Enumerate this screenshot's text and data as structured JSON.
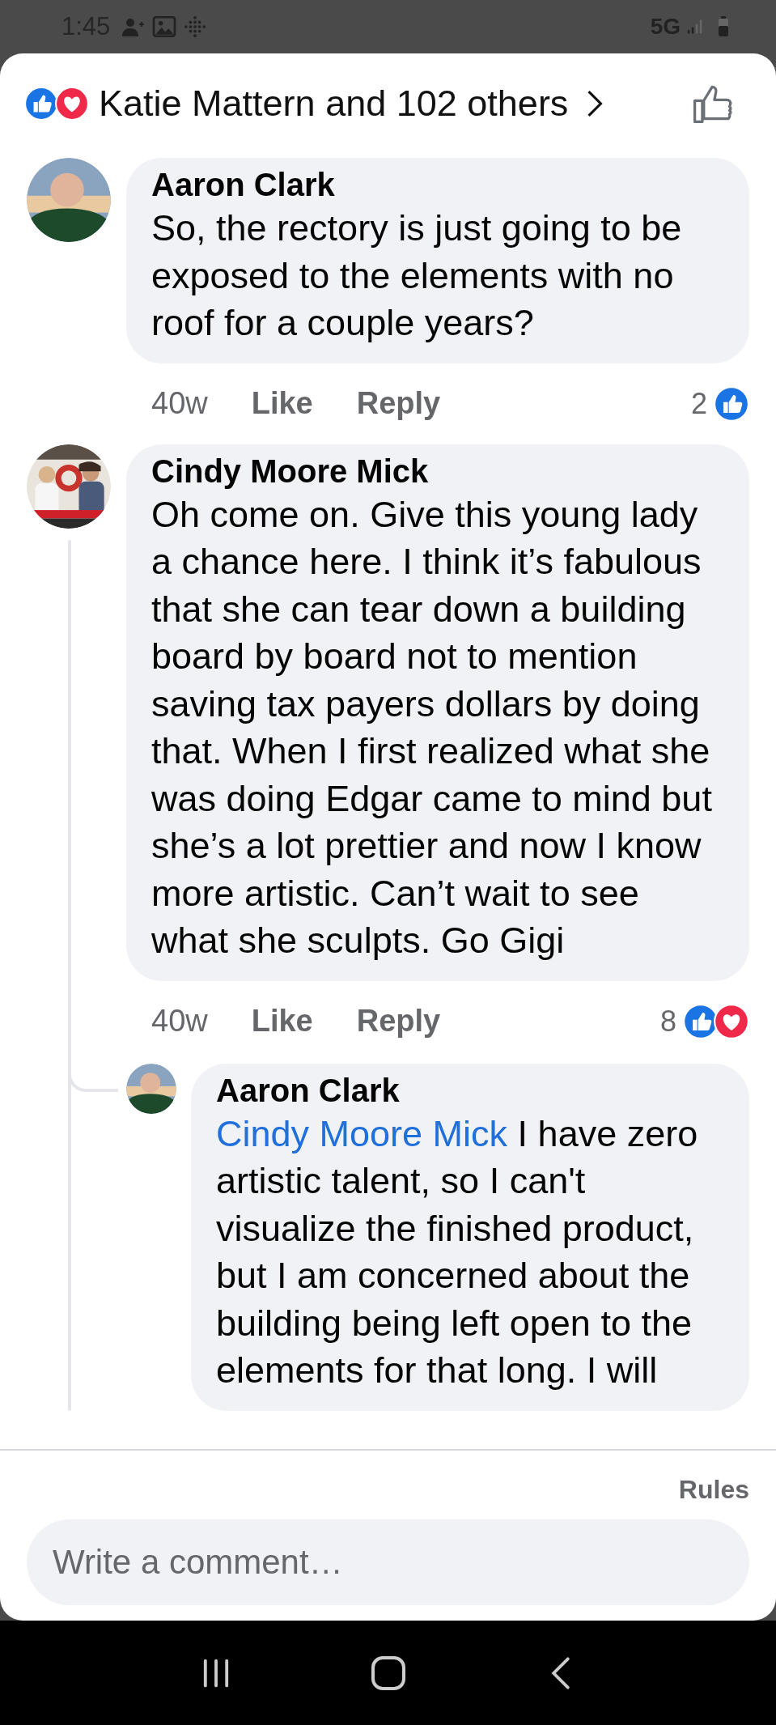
{
  "status_bar": {
    "time": "1:45",
    "network": "5G"
  },
  "header": {
    "reactions": [
      {
        "kind": "like"
      },
      {
        "kind": "heart"
      }
    ],
    "title": "Katie Mattern and 102 others"
  },
  "comments": [
    {
      "author": "Aaron Clark",
      "text": "So, the rectory is just going to be exposed to the elements with no roof for a couple years?",
      "time": "40w",
      "actions": [
        "Like",
        "Reply"
      ],
      "reaction_count": "2",
      "reactions": [
        {
          "kind": "like"
        }
      ]
    },
    {
      "author": "Cindy Moore Mick",
      "text": "Oh come on. Give this young lady a chance here. I think it’s fabulous that she can tear down a building board by board not to mention saving tax payers dollars by doing that. When I first realized what she was doing Edgar came to mind but she’s a lot prettier and now I know more artistic. Can’t wait to see what she sculpts. Go Gigi",
      "time": "40w",
      "actions": [
        "Like",
        "Reply"
      ],
      "reaction_count": "8",
      "reactions": [
        {
          "kind": "like"
        },
        {
          "kind": "heart"
        }
      ],
      "replies": [
        {
          "author": "Aaron Clark",
          "mention": "Cindy Moore Mick",
          "text": "I have zero artistic talent, so I can't visualize the finished product, but I am concerned about the building being left open to the elements for that long.  I will"
        }
      ]
    }
  ],
  "footer": {
    "rules": "Rules",
    "comment_field": {
      "placeholder": "Write a comment…"
    }
  }
}
